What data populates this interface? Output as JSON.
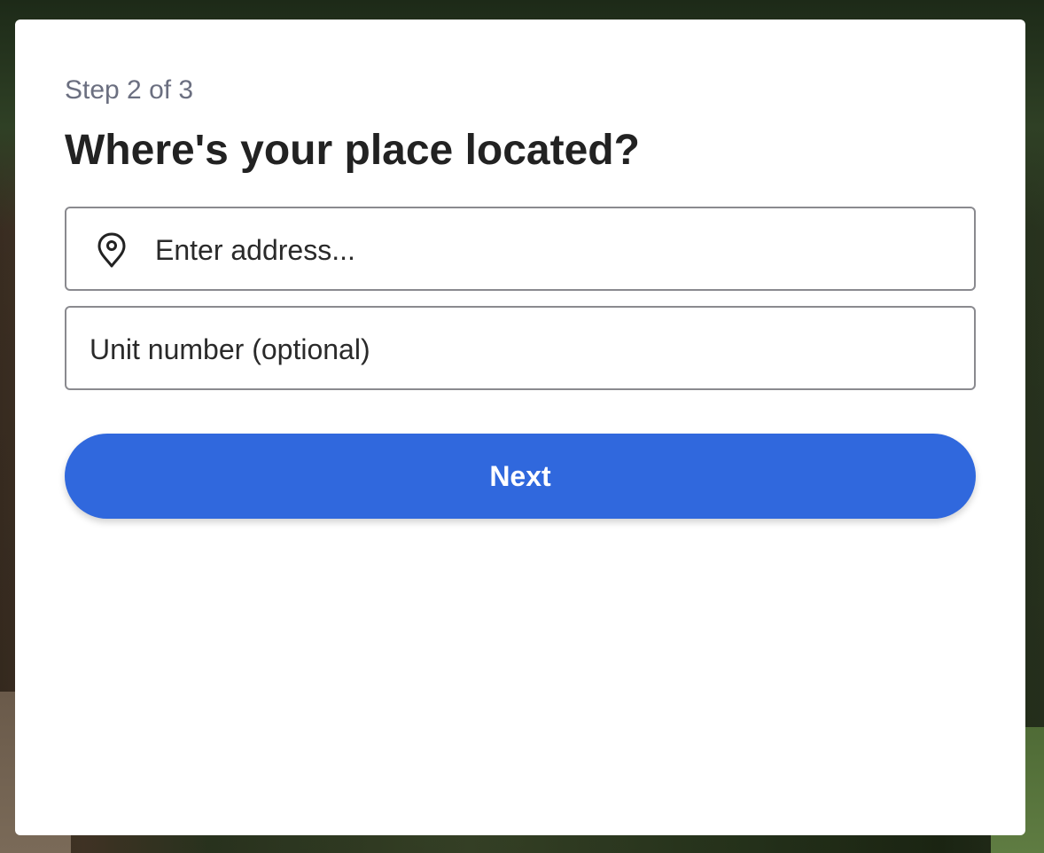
{
  "step": {
    "label": "Step 2 of 3"
  },
  "heading": "Where's your place located?",
  "address_field": {
    "value": "",
    "placeholder": "Enter address...",
    "icon": "map-pin-icon"
  },
  "unit_field": {
    "value": "",
    "placeholder": "Unit number (optional)"
  },
  "next_button": {
    "label": "Next"
  },
  "colors": {
    "primary": "#3068dd",
    "heading": "#222222",
    "step_text": "#6b6f80",
    "field_border": "#8a8a8f"
  }
}
